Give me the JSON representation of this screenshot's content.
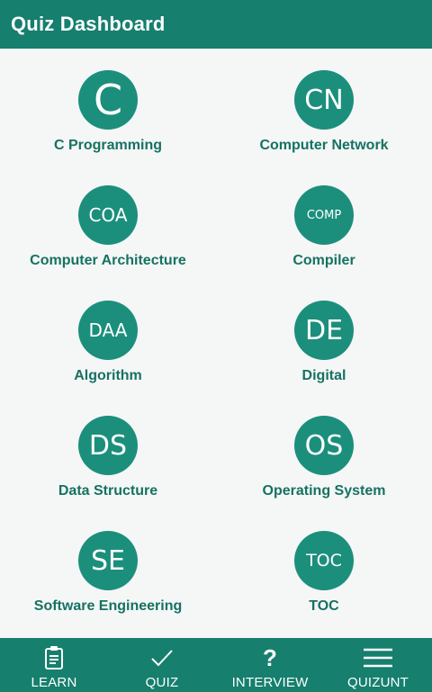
{
  "appbar": {
    "title": "Quiz Dashboard"
  },
  "colors": {
    "primary": "#167f6e",
    "circle": "#1b8f7c",
    "label": "#157262",
    "background": "#f5f6f6"
  },
  "tiles": [
    {
      "abbr": "C",
      "label": "C Programming"
    },
    {
      "abbr": "CN",
      "label": "Computer Network"
    },
    {
      "abbr": "COA",
      "label": "Computer Architecture"
    },
    {
      "abbr": "COMP",
      "label": "Compiler"
    },
    {
      "abbr": "DAA",
      "label": "Algorithm"
    },
    {
      "abbr": "DE",
      "label": "Digital"
    },
    {
      "abbr": "DS",
      "label": "Data Structure"
    },
    {
      "abbr": "OS",
      "label": "Operating System"
    },
    {
      "abbr": "SE",
      "label": "Software Engineering"
    },
    {
      "abbr": "TOC",
      "label": "TOC"
    }
  ],
  "bottom_nav": [
    {
      "label": "LEARN",
      "icon": "clipboard-icon"
    },
    {
      "label": "QUIZ",
      "icon": "checkmark-icon"
    },
    {
      "label": "INTERVIEW",
      "icon": "question-mark-icon"
    },
    {
      "label": "QUIZUNT",
      "icon": "menu-icon"
    }
  ]
}
